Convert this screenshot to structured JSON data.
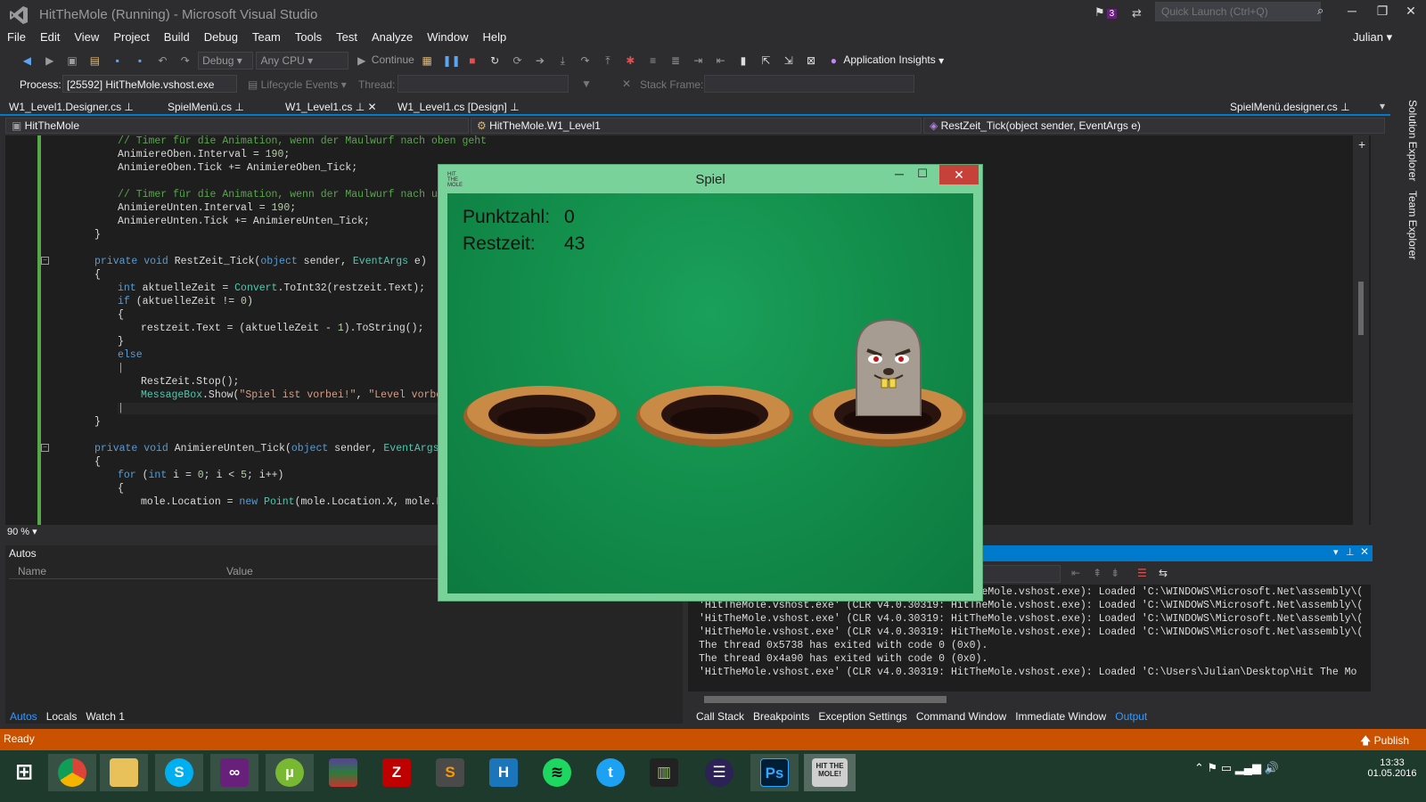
{
  "window": {
    "title": "HitTheMole (Running) - Microsoft Visual Studio",
    "notification_count": "3",
    "quick_launch_placeholder": "Quick Launch (Ctrl+Q)",
    "user": "Julian"
  },
  "menu": [
    "File",
    "Edit",
    "View",
    "Project",
    "Build",
    "Debug",
    "Team",
    "Tools",
    "Test",
    "Analyze",
    "Window",
    "Help"
  ],
  "toolbar": {
    "config": "Debug",
    "platform": "Any CPU",
    "continue_label": "Continue",
    "app_insights": "Application Insights"
  },
  "debugbar": {
    "process_label": "Process:",
    "process_value": "[25592] HitTheMole.vshost.exe",
    "lifecycle": "Lifecycle Events",
    "thread_label": "Thread:",
    "stackframe_label": "Stack Frame:"
  },
  "tabs": {
    "t1": "W1_Level1.Designer.cs",
    "t2": "SpielMenü.cs",
    "t3": "W1_Level1.cs",
    "t4": "W1_Level1.cs [Design]",
    "t5": "SpielMenü.designer.cs"
  },
  "nav": {
    "project": "HitTheMole",
    "class": "HitTheMole.W1_Level1",
    "member": "RestZeit_Tick(object sender, EventArgs e)"
  },
  "side_tabs": {
    "solution": "Solution Explorer",
    "team": "Team Explorer"
  },
  "code": {
    "l1": "// Timer für die Animation, wenn der Maulwurf nach oben geht",
    "l2a": "AnimiereOben.Interval = ",
    "l2b": "190",
    "l2c": ";",
    "l3": "AnimiereOben.Tick += AnimiereOben_Tick;",
    "l5": "// Timer für die Animation, wenn der Maulwurf nach unten",
    "l6a": "AnimiereUnten.Interval = ",
    "l6b": "190",
    "l6c": ";",
    "l7": "AnimiereUnten.Tick += AnimiereUnten_Tick;",
    "l8": "}",
    "l10a": "private void ",
    "l10b": "RestZeit_Tick(",
    "l10c": "object",
    "l10d": " sender, ",
    "l10e": "EventArgs",
    "l10f": " e)",
    "l11": "{",
    "l12a": "int",
    "l12b": " aktuelleZeit = ",
    "l12c": "Convert",
    "l12d": ".ToInt32(restzeit.Text);",
    "l13a": "if",
    "l13b": " (aktuelleZeit != ",
    "l13c": "0",
    "l13d": ")",
    "l14": "{",
    "l15a": "restzeit.Text = (aktuelleZeit - ",
    "l15b": "1",
    "l15c": ").ToString();",
    "l16": "}",
    "l17": "else",
    "l18": "|",
    "l19": "RestZeit.Stop();",
    "l20a": "MessageBox",
    "l20b": ".Show(",
    "l20c": "\"Spiel ist vorbei!\"",
    "l20d": ", ",
    "l20e": "\"Level vorbei\"",
    "l20f": ");",
    "l21": "|",
    "l22": "}",
    "l24a": "private void ",
    "l24b": "AnimiereUnten_Tick(",
    "l24c": "object",
    "l24d": " sender, ",
    "l24e": "EventArgs",
    "l24f": " e)",
    "l25": "{",
    "l26a": "for",
    "l26b": " (",
    "l26c": "int",
    "l26d": " i = ",
    "l26e": "0",
    "l26f": "; i < ",
    "l26g": "5",
    "l26h": "; i++)",
    "l27": "{",
    "l28a": "mole.Location = ",
    "l28b": "new",
    "l28c": " ",
    "l28d": "Point",
    "l28e": "(mole.Location.X, mole.Loca"
  },
  "zoom": "90 %",
  "autos": {
    "title": "Autos",
    "col_name": "Name",
    "col_value": "Value"
  },
  "bottom_tabs_left": [
    "Autos",
    "Locals",
    "Watch 1"
  ],
  "output_lines": [
    "'HitTheMole.vshost.exe' (CLR v4.0.30319: HitTheMole.vshost.exe): Loaded 'C:\\WINDOWS\\Microsoft.Net\\assembly\\(",
    "'HitTheMole.vshost.exe' (CLR v4.0.30319: HitTheMole.vshost.exe): Loaded 'C:\\WINDOWS\\Microsoft.Net\\assembly\\(",
    "'HitTheMole.vshost.exe' (CLR v4.0.30319: HitTheMole.vshost.exe): Loaded 'C:\\WINDOWS\\Microsoft.Net\\assembly\\(",
    "'HitTheMole.vshost.exe' (CLR v4.0.30319: HitTheMole.vshost.exe): Loaded 'C:\\WINDOWS\\Microsoft.Net\\assembly\\(",
    "The thread 0x5738 has exited with code 0 (0x0).",
    "The thread 0x4a90 has exited with code 0 (0x0).",
    "'HitTheMole.vshost.exe' (CLR v4.0.30319: HitTheMole.vshost.exe): Loaded 'C:\\Users\\Julian\\Desktop\\Hit The Mo"
  ],
  "bottom_tabs_right": [
    "Call Stack",
    "Breakpoints",
    "Exception Settings",
    "Command Window",
    "Immediate Window",
    "Output"
  ],
  "status": {
    "text": "Ready",
    "publish": "Publish"
  },
  "game": {
    "title": "Spiel",
    "score_label": "Punktzahl:",
    "score_value": "0",
    "time_label": "Restzeit:",
    "time_value": "43",
    "icon_text": "HIT THE MOLE"
  },
  "taskbar": {
    "apps": [
      "windows-start",
      "chrome",
      "file-explorer",
      "skype",
      "visual-studio",
      "utorrent",
      "winrar",
      "filezilla",
      "sublime-text",
      "hyper",
      "spotify",
      "twitter",
      "vegas",
      "eclipse",
      "photoshop",
      "hit-the-mole"
    ],
    "game_app_label": "HIT THE MOLE!",
    "time": "13:33",
    "date": "01.05.2016"
  },
  "colors": {
    "accent": "#007acc",
    "statusbar": "#ca5100",
    "game_border": "#79d29a",
    "game_bg": "#138f4c",
    "close": "#c7413b"
  }
}
